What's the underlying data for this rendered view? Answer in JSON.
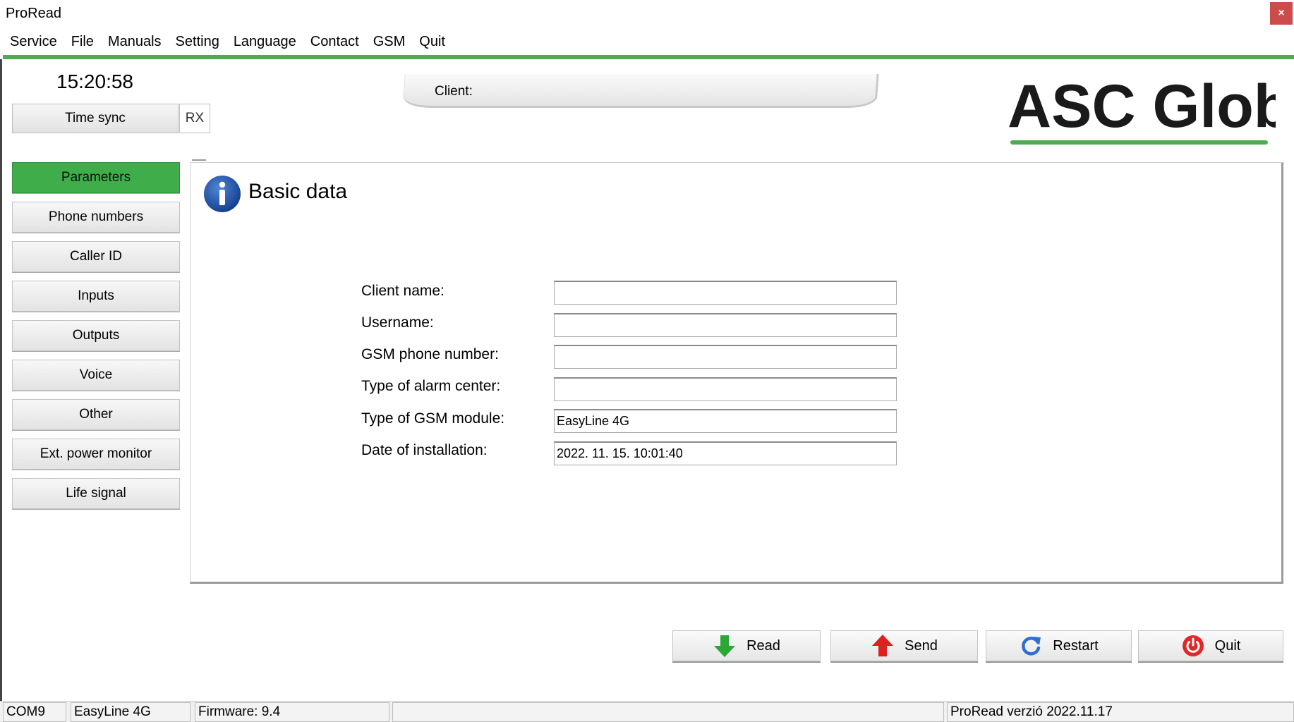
{
  "window": {
    "title": "ProRead",
    "close_label": "×"
  },
  "menu": [
    "Service",
    "File",
    "Manuals",
    "Setting",
    "Language",
    "Contact",
    "GSM",
    "Quit"
  ],
  "clock": "15:20:58",
  "time_sync_label": "Time sync",
  "rx_label": "RX",
  "client_label": "Client:",
  "logo": {
    "text": "ASC Global",
    "accent": "#4dac4f"
  },
  "sidebar": [
    {
      "label": "Parameters",
      "active": true
    },
    {
      "label": "Phone numbers"
    },
    {
      "label": "Caller ID"
    },
    {
      "label": "Inputs"
    },
    {
      "label": "Outputs"
    },
    {
      "label": "Voice"
    },
    {
      "label": "Other"
    },
    {
      "label": "Ext. power monitor"
    },
    {
      "label": "Life signal"
    }
  ],
  "panel": {
    "title": "Basic data",
    "icon": "info-icon",
    "fields": [
      {
        "label": "Client name:",
        "value": ""
      },
      {
        "label": "Username:",
        "value": ""
      },
      {
        "label": "GSM phone number:",
        "value": ""
      },
      {
        "label": "Type of alarm center:",
        "value": ""
      },
      {
        "label": "Type of GSM module:",
        "value": "EasyLine 4G"
      },
      {
        "label": "Date of installation:",
        "value": "2022. 11. 15. 10:01:40"
      }
    ]
  },
  "actions": {
    "read": "Read",
    "send": "Send",
    "restart": "Restart",
    "quit": "Quit"
  },
  "status": {
    "port": "COM9",
    "module": "EasyLine 4G",
    "firmware": "Firmware: 9.4",
    "message": "",
    "version": "ProRead verzió 2022.11.17"
  },
  "colors": {
    "accent_green": "#4dac4f",
    "active_button": "#3fae4a",
    "close_red": "#cc4b4b",
    "info_blue": "#1f4fa0"
  }
}
